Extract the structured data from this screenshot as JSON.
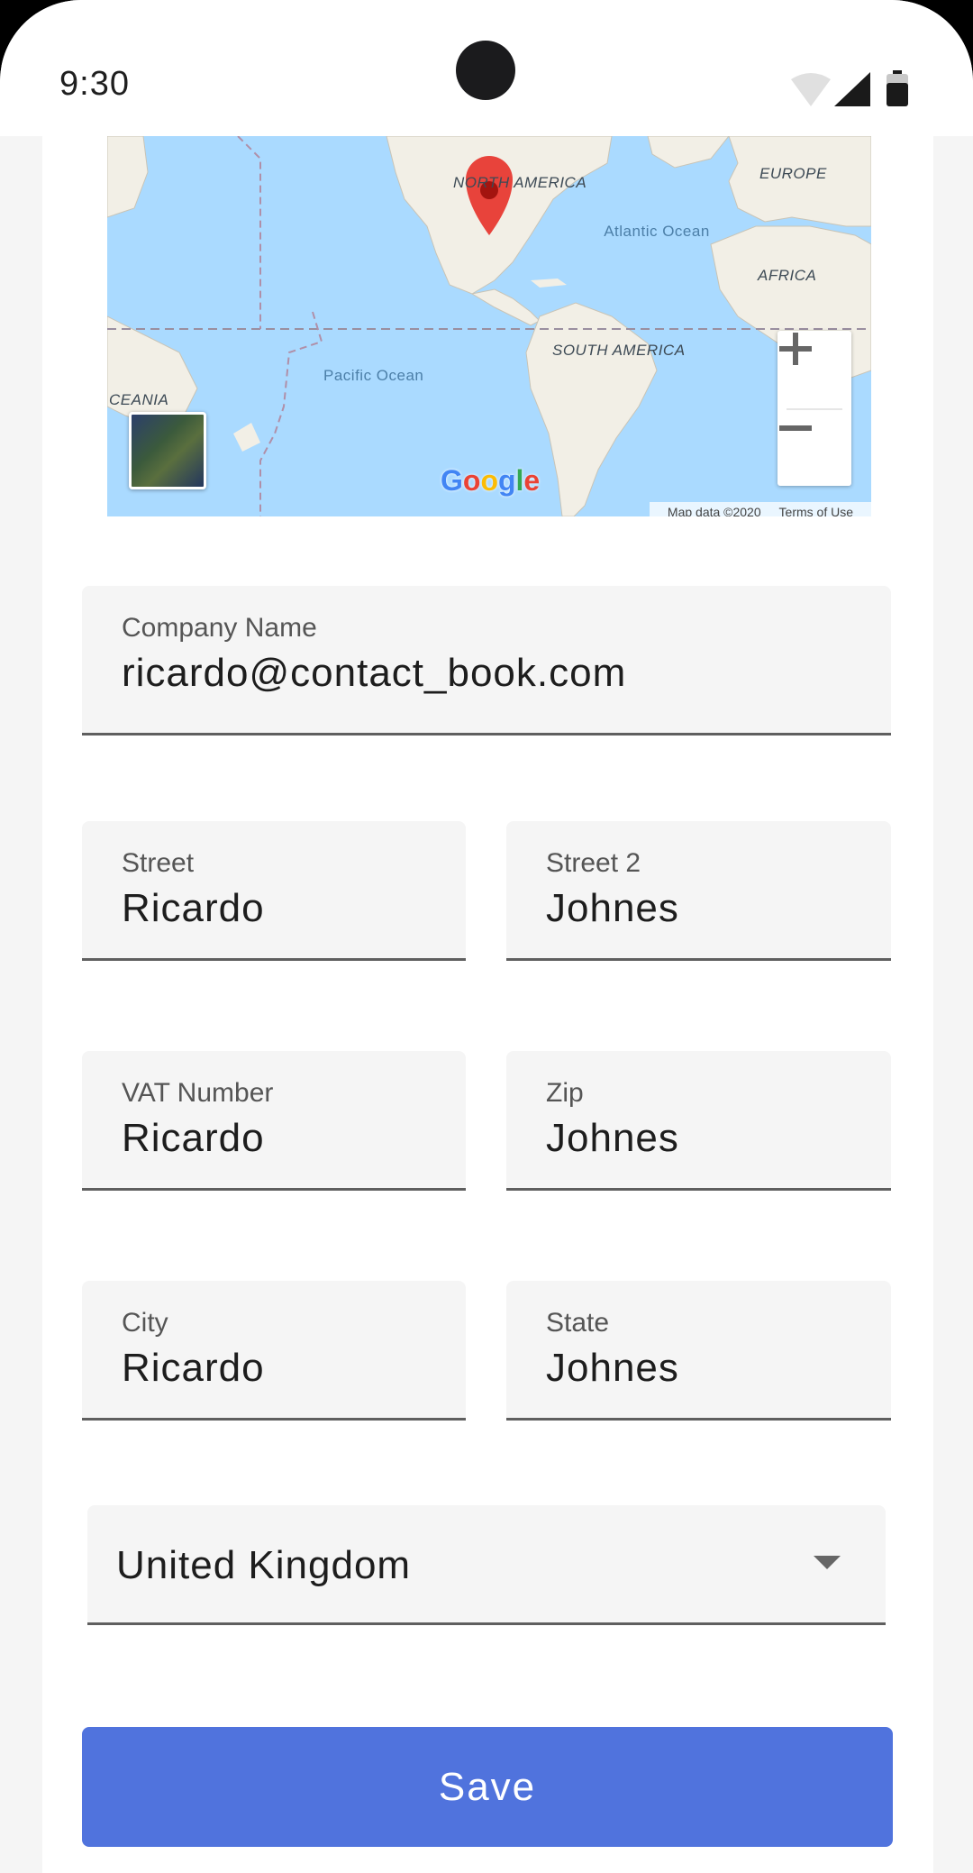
{
  "status_bar": {
    "time": "9:30",
    "icons": [
      "wifi-icon",
      "cellular-signal-icon",
      "battery-icon"
    ]
  },
  "map": {
    "labels": {
      "north_america": "NORTH AMERICA",
      "europe": "EUROPE",
      "atlantic": "Atlantic Ocean",
      "africa": "AFRICA",
      "south_america": "SOUTH AMERICA",
      "pacific": "Pacific Ocean",
      "oceania": "CEANIA"
    },
    "zoom_in": "+",
    "zoom_out": "−",
    "logo": "Google",
    "attribution_data": "Map data ©2020",
    "attribution_terms": "Terms of Use"
  },
  "form": {
    "company_name": {
      "label": "Company Name",
      "value": "ricardo@contact_book.com"
    },
    "street": {
      "label": "Street",
      "value": "Ricardo"
    },
    "street2": {
      "label": "Street 2",
      "value": "Johnes"
    },
    "vat_number": {
      "label": "VAT Number",
      "value": "Ricardo"
    },
    "zip": {
      "label": "Zip",
      "value": "Johnes"
    },
    "city": {
      "label": "City",
      "value": "Ricardo"
    },
    "state": {
      "label": "State",
      "value": "Johnes"
    },
    "country": {
      "value": "United Kingdom"
    },
    "save_label": "Save"
  },
  "colors": {
    "primary": "#5073dd",
    "field_bg": "#f5f5f5",
    "map_water": "#aadaff",
    "map_land": "#f2efe6",
    "marker": "#e8433b"
  }
}
